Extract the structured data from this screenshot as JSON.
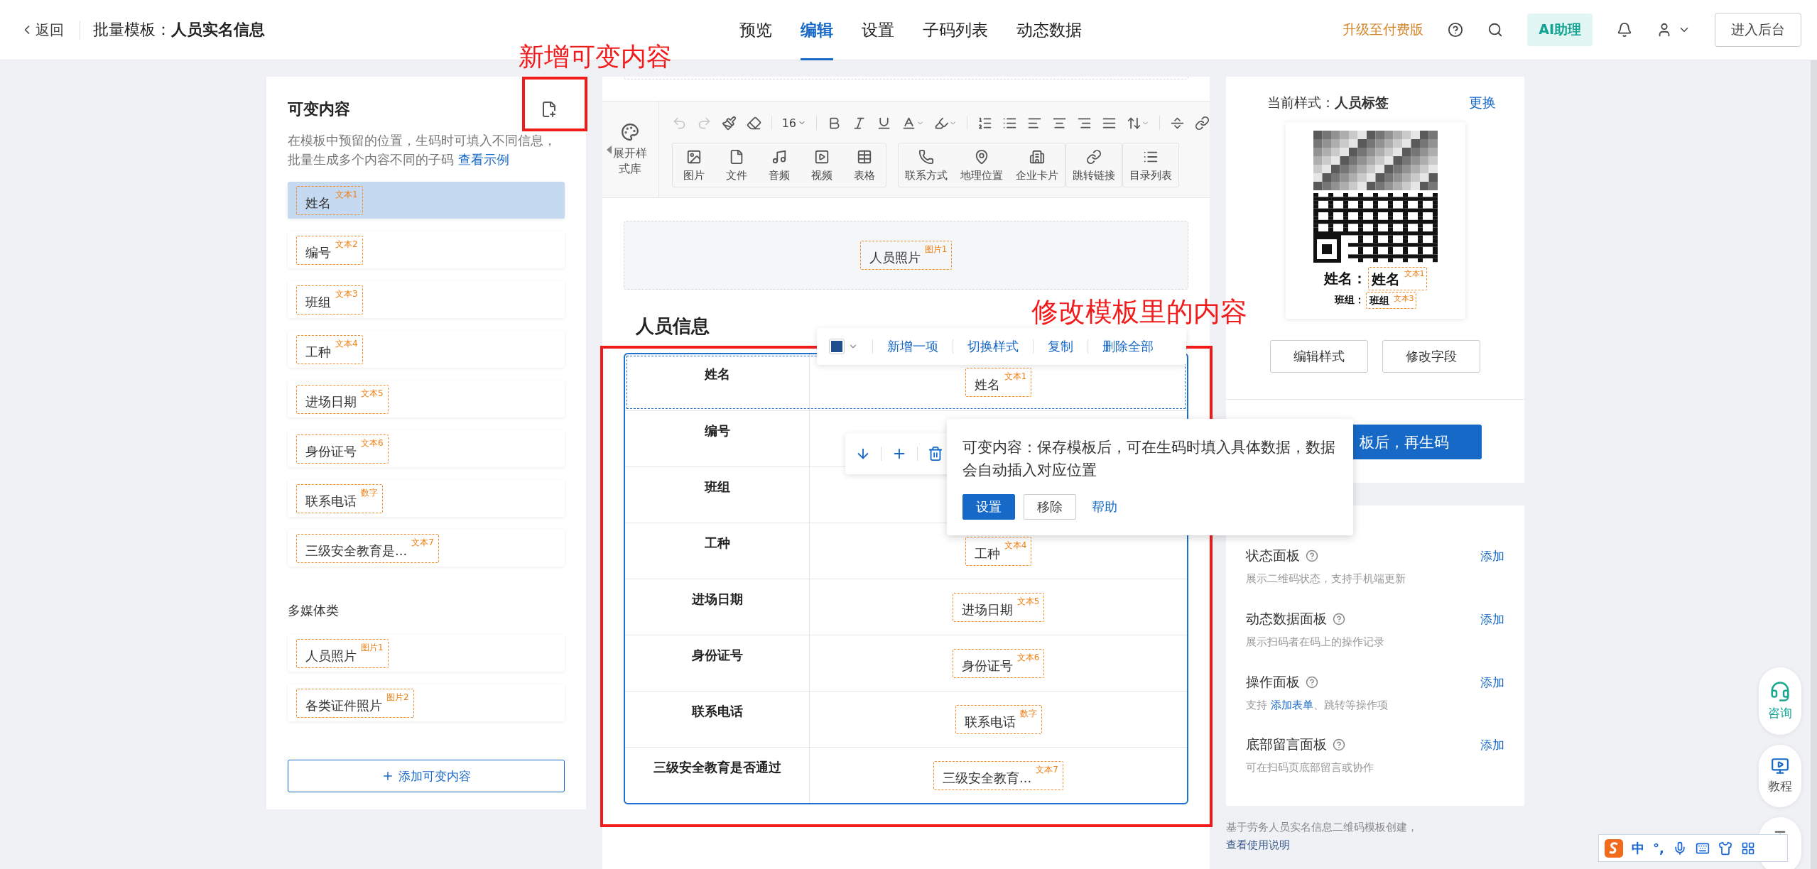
{
  "header": {
    "back": "返回",
    "title_prefix": "批量模板：",
    "title": "人员实名信息",
    "tabs": [
      {
        "label": "预览",
        "selected": false
      },
      {
        "label": "编辑",
        "selected": true
      },
      {
        "label": "设置",
        "selected": false
      },
      {
        "label": "子码列表",
        "selected": false
      },
      {
        "label": "动态数据",
        "selected": false
      }
    ],
    "upgrade": "升级至付费版",
    "ai": "AI助理",
    "admin": "进入后台"
  },
  "annotations": [
    "新增可变内容",
    "修改模板里的内容"
  ],
  "variables": {
    "title": "可变内容",
    "description": "在模板中预留的位置，生码时可填入不同信息，批量生成多个内容不同的子码",
    "example_link": "查看示例",
    "items": [
      {
        "label": "姓名",
        "tag": "文本1",
        "selected": true
      },
      {
        "label": "编号",
        "tag": "文本2",
        "selected": false
      },
      {
        "label": "班组",
        "tag": "文本3",
        "selected": false
      },
      {
        "label": "工种",
        "tag": "文本4",
        "selected": false
      },
      {
        "label": "进场日期",
        "tag": "文本5",
        "selected": false
      },
      {
        "label": "身份证号",
        "tag": "文本6",
        "selected": false
      },
      {
        "label": "联系电话",
        "tag": "数字",
        "selected": false
      },
      {
        "label": "三级安全教育是...",
        "tag": "文本7",
        "selected": false
      }
    ],
    "media_title": "多媒体类",
    "media_items": [
      {
        "label": "人员照片",
        "tag": "图片1",
        "selected": false
      },
      {
        "label": "各类证件照片",
        "tag": "图片2",
        "selected": false
      }
    ],
    "add_button": "添加可变内容"
  },
  "editor": {
    "style_library": "展开样式库",
    "font_size": "16",
    "insert_groups": [
      [
        "图片",
        "文件",
        "音频",
        "视频",
        "表格"
      ],
      [
        "联系方式",
        "地理位置",
        "企业卡片"
      ],
      [
        "跳转链接"
      ],
      [
        "目录列表"
      ]
    ],
    "photo_block": {
      "label": "人员照片",
      "tag": "图片1"
    },
    "section_title": "人员信息",
    "table_actions": [
      "新增一项",
      "切换样式",
      "复制",
      "删除全部"
    ],
    "rows": [
      {
        "label": "姓名",
        "value": "姓名",
        "tag": "文本1",
        "selected": true
      },
      {
        "label": "编号",
        "selected": false
      },
      {
        "label": "班组",
        "selected": false
      },
      {
        "label": "工种",
        "value": "工种",
        "tag": "文本4",
        "selected": false
      },
      {
        "label": "进场日期",
        "value": "进场日期",
        "tag": "文本5",
        "selected": false
      },
      {
        "label": "身份证号",
        "value": "身份证号",
        "tag": "文本6",
        "selected": false
      },
      {
        "label": "联系电话",
        "value": "联系电话",
        "tag": "数字",
        "selected": false
      },
      {
        "label": "三级安全教育是否通过",
        "value": "三级安全教育...",
        "tag": "文本7",
        "selected": false
      }
    ],
    "popover": {
      "text": "可变内容：保存模板后，可在生码时填入具体数据，数据会自动插入对应位置",
      "buttons": [
        {
          "label": "设置",
          "kind": "primary"
        },
        {
          "label": "移除",
          "kind": "default"
        }
      ],
      "help": "帮助"
    }
  },
  "style_panel": {
    "label": "当前样式：",
    "name": "人员标签",
    "change": "更换",
    "fields": [
      {
        "label": "姓名：",
        "value": "姓名",
        "tag": "文本1"
      },
      {
        "label": "班组：",
        "value": "班组",
        "tag": "文本3"
      }
    ],
    "buttons": [
      "编辑样式",
      "修改字段"
    ],
    "generate": "板后，再生码"
  },
  "panels": [
    {
      "title": "状态面板",
      "description": "展示二维码状态，支持手机端更新",
      "action": "添加"
    },
    {
      "title": "动态数据面板",
      "description": "展示扫码者在码上的操作记录",
      "action": "添加"
    },
    {
      "title": "操作面板",
      "description": "支持 ",
      "link": "添加表单",
      "description_end": "、跳转等操作项",
      "action": "添加"
    },
    {
      "title": "底部留言面板",
      "description": "可在扫码页底部留言或协作",
      "action": "添加"
    }
  ],
  "footer": {
    "text": "基于劳务人员实名信息二维码模板创建，",
    "link": "查看使用说明"
  },
  "float_buttons": [
    {
      "kind": "consult",
      "label": "咨询"
    },
    {
      "kind": "tutorial",
      "label": "教程"
    },
    {
      "kind": "top"
    }
  ],
  "ime": {
    "items": [
      "中",
      "°,"
    ]
  }
}
